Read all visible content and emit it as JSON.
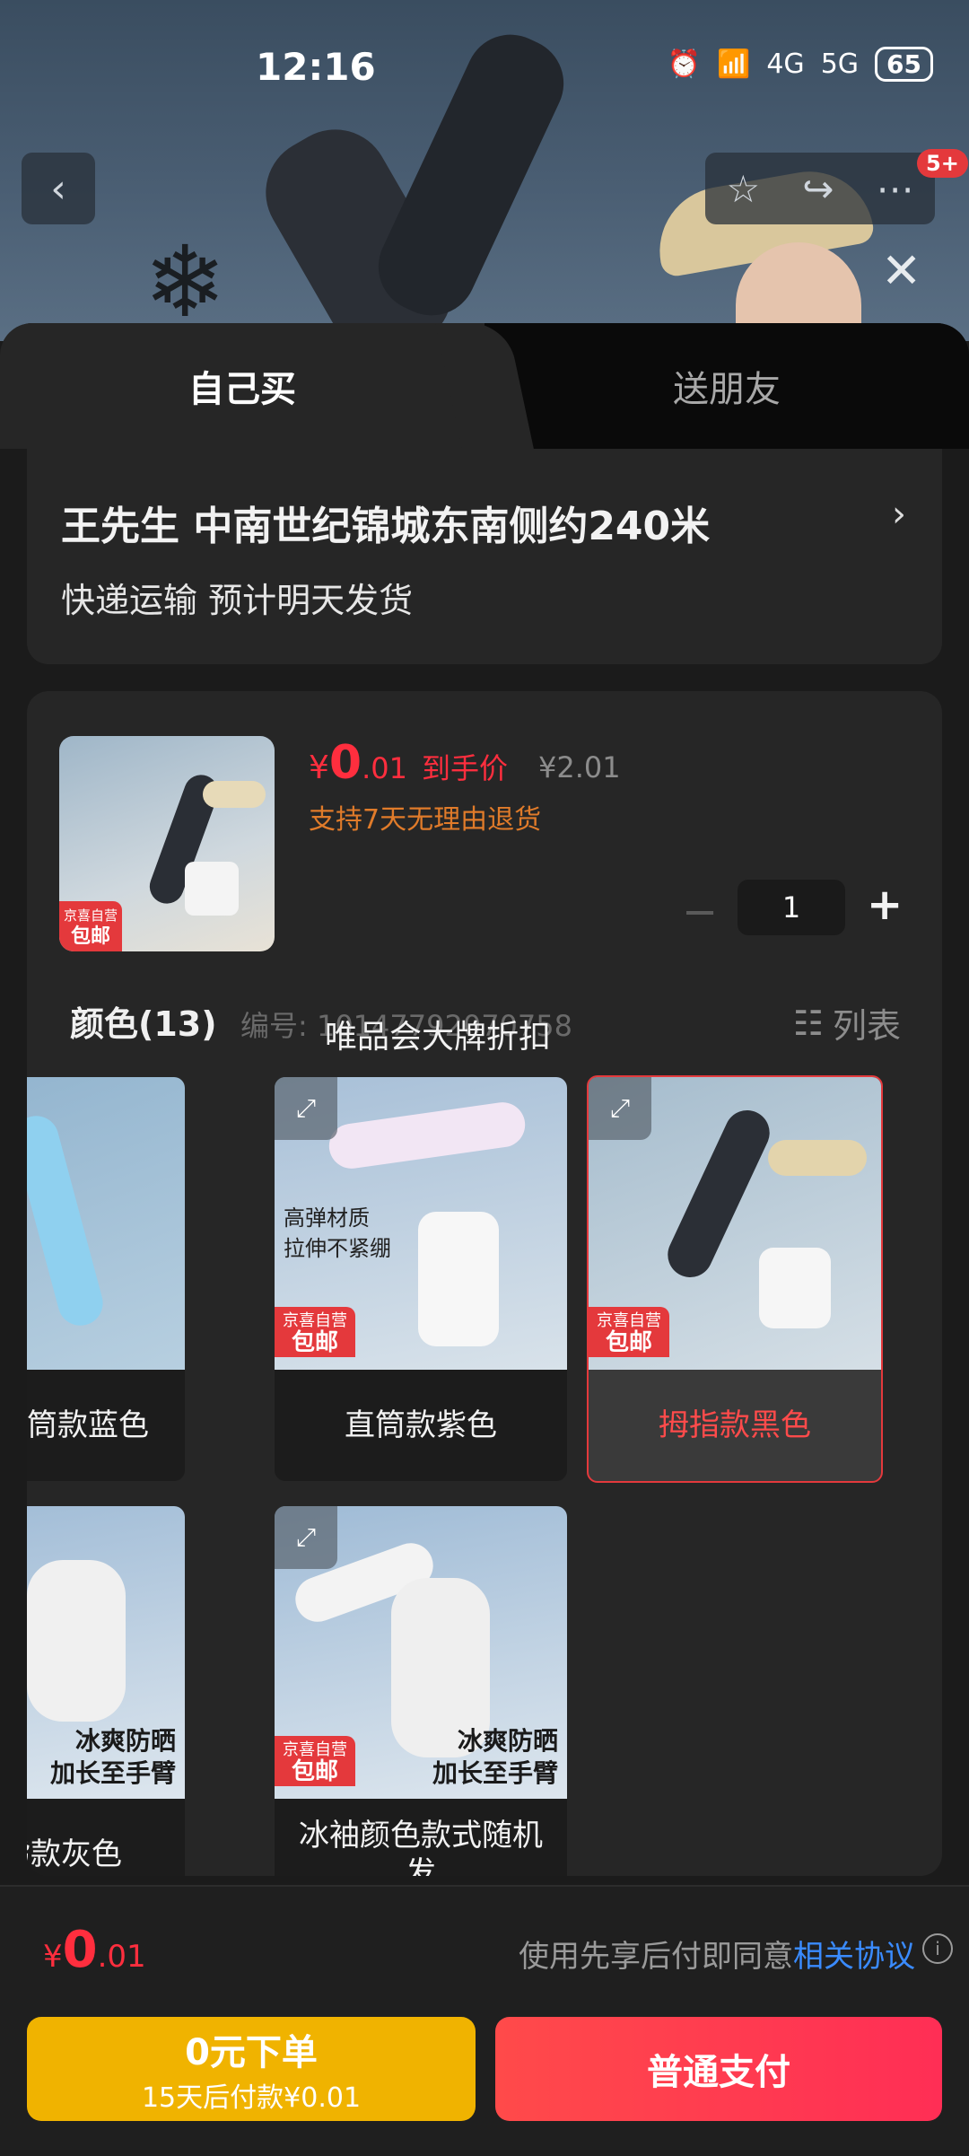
{
  "status": {
    "time": "12:16",
    "network1": "4G",
    "network2": "5G",
    "battery": "65"
  },
  "header": {
    "badge": "5+"
  },
  "tabs": [
    {
      "label": "自己买"
    },
    {
      "label": "送朋友"
    }
  ],
  "address": {
    "line1": "王先生  中南世纪锦城东南侧约240米",
    "line2": "快递运输 预计明天发货"
  },
  "product": {
    "price_currency": "¥",
    "price_int": "0",
    "price_dec": ".01",
    "price_label": "到手价",
    "original_price": "¥2.01",
    "return_note": "支持7天无理由退货",
    "tag_top": "京喜自营",
    "tag_bottom": "包邮",
    "quantity": "1"
  },
  "colors": {
    "title": "颜色(13)",
    "code_label": "编号: 10147792070758",
    "overlay": "唯品会大牌折扣",
    "list_label": "列表",
    "options": [
      {
        "label": "筒款蓝色"
      },
      {
        "label": "直筒款紫色",
        "promo_l1": "高弹材质",
        "promo_l2": "拉伸不紧绷"
      },
      {
        "label": "拇指款黑色"
      },
      {
        "label": "指款灰色",
        "promo_l1": "冰爽防晒",
        "promo_l2": "加长至手臂"
      },
      {
        "label": "冰袖颜色款式随机发",
        "promo_l1": "冰爽防晒",
        "promo_l2": "加长至手臂"
      }
    ]
  },
  "bottom": {
    "price_currency": "¥",
    "price_int": "0",
    "price_dec": ".01",
    "agree_text": "使用先享后付即同意",
    "agree_link": "相关协议",
    "btn_left_l1": "0元下单",
    "btn_left_l2": "15天后付款¥0.01",
    "btn_right": "普通支付"
  },
  "colors_theme": {
    "accent": "#e4393c",
    "price": "#ff2e3e",
    "yellow": "#f0b300",
    "link": "#3a8bff"
  }
}
